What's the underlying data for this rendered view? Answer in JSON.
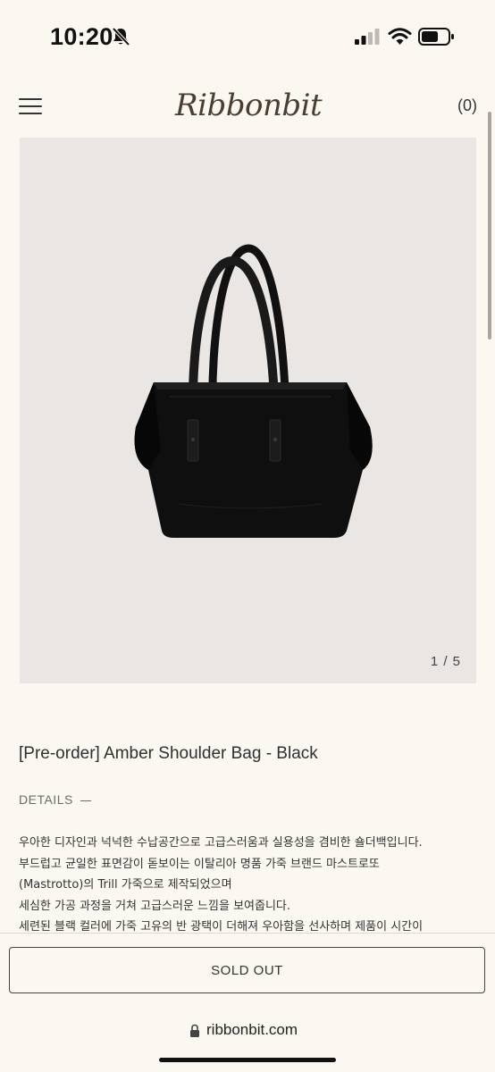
{
  "status": {
    "time": "10:20"
  },
  "header": {
    "logo": "Ribbonbit",
    "cart": "(0)"
  },
  "gallery": {
    "counter": "1 / 5"
  },
  "product": {
    "title": "[Pre-order] Amber Shoulder Bag - Black"
  },
  "details": {
    "label": "DETAILS",
    "lines": [
      "우아한 디자인과 넉넉한 수납공간으로 고급스러움과 실용성을 겸비한 숄더백입니다.",
      "부드럽고 균일한 표면감이 돋보이는 이탈리아 명품 가죽 브랜드 마스트로또",
      "(Mastrotto)의 Trill 가죽으로 제작되었으며",
      "세심한 가공 과정을 거쳐 고급스러운 느낌을 보여줍니다.",
      "세련된 블랙 컬러에 가죽 고유의 반 광택이 더해져 우아함을 선사하며 제품이 시간이"
    ]
  },
  "actions": {
    "sold_out": "SOLD OUT"
  },
  "browser": {
    "url": "ribbonbit.com"
  }
}
